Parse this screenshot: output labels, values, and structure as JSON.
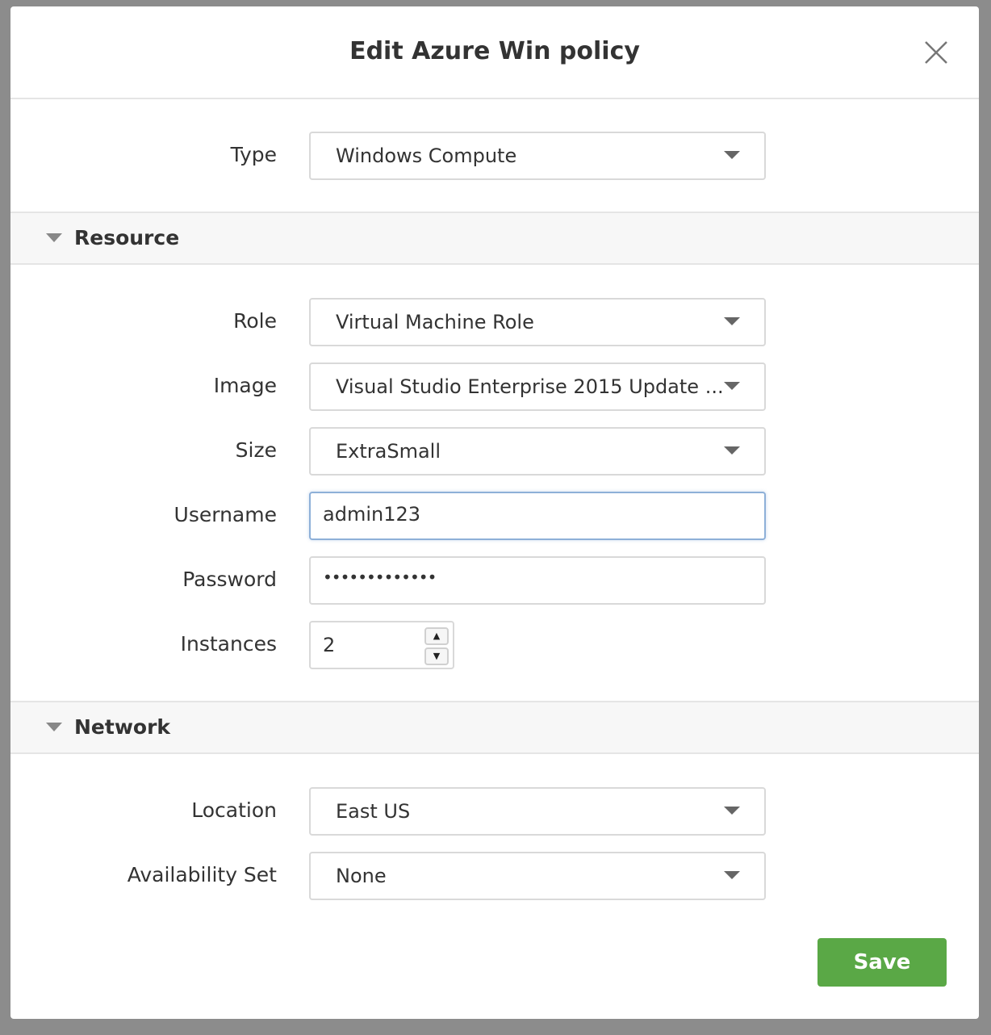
{
  "dialog": {
    "title": "Edit Azure Win policy",
    "close_icon": "close-icon"
  },
  "type": {
    "label": "Type",
    "value": "Windows Compute"
  },
  "resource": {
    "title": "Resource",
    "role": {
      "label": "Role",
      "value": "Virtual Machine Role"
    },
    "image": {
      "label": "Image",
      "value": "Visual Studio Enterprise 2015 Update ..."
    },
    "size": {
      "label": "Size",
      "value": "ExtraSmall"
    },
    "username": {
      "label": "Username",
      "value": "admin123"
    },
    "password": {
      "label": "Password",
      "value": "•••••••••••••"
    },
    "instances": {
      "label": "Instances",
      "value": "2",
      "up": "▲",
      "down": "▼"
    }
  },
  "network": {
    "title": "Network",
    "location": {
      "label": "Location",
      "value": "East US"
    },
    "availability_set": {
      "label": "Availability Set",
      "value": "None"
    }
  },
  "save_label": "Save",
  "colors": {
    "save": "#5aa846",
    "focus_border": "#8eb0d8"
  }
}
